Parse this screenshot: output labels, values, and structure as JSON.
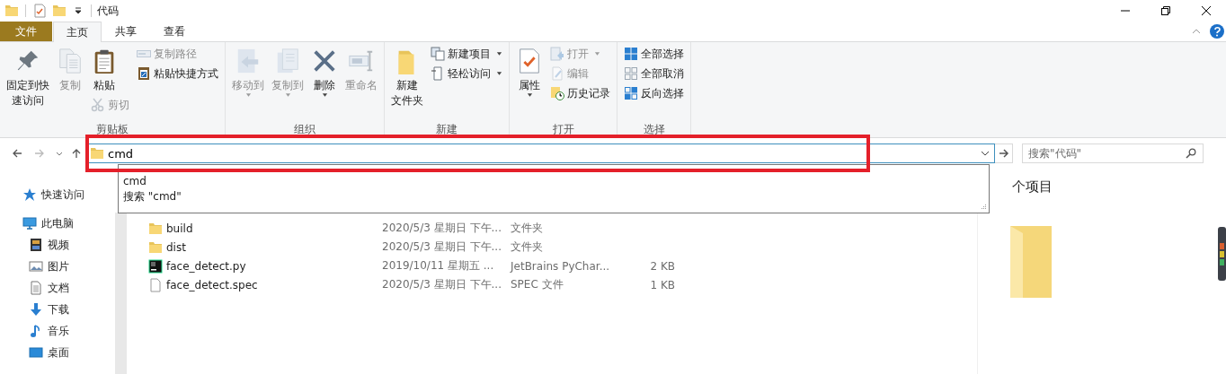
{
  "title_bar": {
    "title": "代码"
  },
  "ribbon_tabs": [
    {
      "label": "文件",
      "kind": "menu",
      "selected": false
    },
    {
      "label": "主页",
      "kind": "tab",
      "selected": true
    },
    {
      "label": "共享",
      "kind": "tab",
      "selected": false
    },
    {
      "label": "查看",
      "kind": "tab",
      "selected": false
    }
  ],
  "ribbon_groups": [
    {
      "label": "剪贴板",
      "columns": [
        {
          "items": [
            {
              "lines": [
                "固定到快",
                "速访问"
              ],
              "kind": "large",
              "disabled": false,
              "has_menu": false
            }
          ]
        },
        {
          "items": [
            {
              "lines": [
                "复制"
              ],
              "kind": "large",
              "disabled": true,
              "has_menu": false
            }
          ]
        },
        {
          "items": [
            {
              "lines": [
                "粘贴"
              ],
              "kind": "large",
              "disabled": false,
              "has_menu": false
            },
            {
              "lines": [
                "剪切"
              ],
              "kind": "small",
              "disabled": true,
              "has_menu": false
            }
          ]
        },
        {
          "items": [
            {
              "lines": [
                "复制路径"
              ],
              "kind": "small",
              "disabled": true,
              "has_menu": false
            },
            {
              "lines": [
                "粘贴快捷方式"
              ],
              "kind": "small",
              "disabled": false,
              "has_menu": false
            }
          ]
        }
      ]
    },
    {
      "label": "组织",
      "columns": [
        {
          "items": [
            {
              "lines": [
                "移动到"
              ],
              "kind": "large",
              "disabled": true,
              "has_menu": true
            }
          ]
        },
        {
          "items": [
            {
              "lines": [
                "复制到"
              ],
              "kind": "large",
              "disabled": true,
              "has_menu": true
            }
          ]
        },
        {
          "items": [
            {
              "lines": [
                "删除"
              ],
              "kind": "large",
              "disabled": false,
              "has_menu": true
            }
          ]
        },
        {
          "items": [
            {
              "lines": [
                "重命名"
              ],
              "kind": "large",
              "disabled": true,
              "has_menu": false
            }
          ]
        }
      ]
    },
    {
      "label": "新建",
      "columns": [
        {
          "items": [
            {
              "lines": [
                "新建",
                "文件夹"
              ],
              "kind": "large",
              "disabled": false,
              "has_menu": false
            }
          ]
        },
        {
          "items": [
            {
              "lines": [
                "新建项目"
              ],
              "kind": "small",
              "disabled": false,
              "has_menu": true
            },
            {
              "lines": [
                "轻松访问"
              ],
              "kind": "small",
              "disabled": false,
              "has_menu": true
            }
          ]
        }
      ]
    },
    {
      "label": "打开",
      "columns": [
        {
          "items": [
            {
              "lines": [
                "属性"
              ],
              "kind": "large",
              "disabled": false,
              "has_menu": true
            }
          ]
        },
        {
          "items": [
            {
              "lines": [
                "打开"
              ],
              "kind": "small",
              "disabled": true,
              "has_menu": true
            },
            {
              "lines": [
                "编辑"
              ],
              "kind": "small",
              "disabled": true,
              "has_menu": false
            },
            {
              "lines": [
                "历史记录"
              ],
              "kind": "small",
              "disabled": false,
              "has_menu": false
            }
          ]
        }
      ]
    },
    {
      "label": "选择",
      "columns": [
        {
          "items": [
            {
              "lines": [
                "全部选择"
              ],
              "kind": "small",
              "disabled": false,
              "has_menu": false
            },
            {
              "lines": [
                "全部取消"
              ],
              "kind": "small",
              "disabled": false,
              "has_menu": false
            },
            {
              "lines": [
                "反向选择"
              ],
              "kind": "small",
              "disabled": false,
              "has_menu": false
            }
          ]
        }
      ]
    }
  ],
  "address_bar": {
    "value": "cmd"
  },
  "search": {
    "placeholder": "搜索\"代码\""
  },
  "autocomplete": {
    "items": [
      "cmd",
      "搜索 \"cmd\""
    ]
  },
  "sidebar": {
    "items": [
      {
        "label": "快速访问"
      },
      {
        "label": "此电脑",
        "children": [
          {
            "label": "视频"
          },
          {
            "label": "图片"
          },
          {
            "label": "文档"
          },
          {
            "label": "下载"
          },
          {
            "label": "音乐"
          },
          {
            "label": "桌面"
          }
        ]
      }
    ]
  },
  "files": [
    {
      "name": "build",
      "kind": "folder",
      "date": "2020/5/3 星期日 下午...",
      "type": "文件夹"
    },
    {
      "name": "dist",
      "kind": "folder",
      "date": "2020/5/3 星期日 下午...",
      "type": "文件夹"
    },
    {
      "name": "face_detect.py",
      "kind": "pycharm",
      "date": "2019/10/11 星期五 ...",
      "type": "JetBrains PyChar...",
      "size": "2 KB"
    },
    {
      "name": "face_detect.spec",
      "kind": "file",
      "date": "2020/5/3 星期日 下午...",
      "type": "SPEC 文件",
      "size": "1 KB"
    }
  ],
  "preview": {
    "caption": "个项目"
  }
}
